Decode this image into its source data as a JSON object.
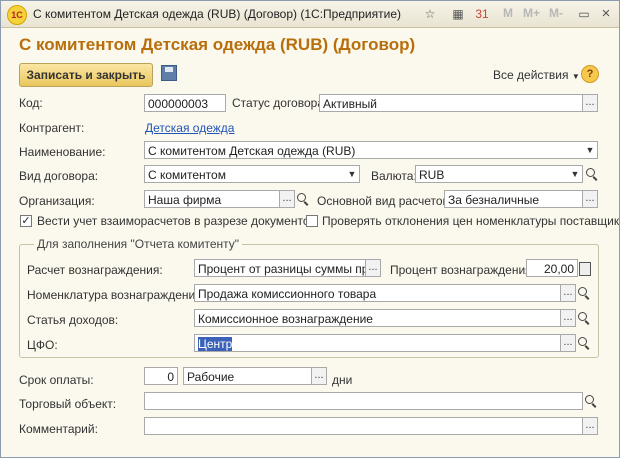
{
  "window": {
    "title": "С комитентом Детская одежда (RUB) (Договор)  (1С:Предприятие)",
    "logo_text": "1С",
    "toolbar": {
      "star_icon": "star-icon",
      "calc_icon": "calculator-icon",
      "calendar_icon": "calendar-icon",
      "calendar_text": "31",
      "mem_m": "M",
      "mem_mplus": "M+",
      "mem_mminus": "M-",
      "restore_icon": "restore-icon",
      "close_label": "×"
    }
  },
  "form": {
    "heading": "С комитентом Детская одежда (RUB) (Договор)",
    "save_close_label": "Записать и закрыть",
    "all_actions_label": "Все действия",
    "help_label": "?"
  },
  "fields": {
    "code_label": "Код:",
    "code_value": "000000003",
    "status_label": "Статус договора:",
    "status_value": "Активный",
    "counterparty_label": "Контрагент:",
    "counterparty_value": "Детская одежда",
    "name_label": "Наименование:",
    "name_value": "С комитентом Детская одежда (RUB)",
    "contract_type_label": "Вид договора:",
    "contract_type_value": "С комитентом",
    "currency_label": "Валюта:",
    "currency_value": "RUB",
    "org_label": "Организация:",
    "org_value": "Наша фирма",
    "settlement_label": "Основной вид расчетов:",
    "settlement_value": "За безналичные",
    "track_docs_label": "Вести учет взаиморасчетов в разрезе документов",
    "track_docs_checked": true,
    "check_prices_label": "Проверять отклонения цен номенклатуры поставщика",
    "check_prices_checked": false
  },
  "group": {
    "title": "Для заполнения \"Отчета комитенту\"",
    "reward_calc_label": "Расчет вознаграждения:",
    "reward_calc_value": "Процент от разницы суммы прод",
    "reward_percent_label": "Процент вознаграждения:",
    "reward_percent_value": "20,00",
    "reward_item_label": "Номенклатура вознаграждения:",
    "reward_item_value": "Продажа комиссионного товара",
    "income_item_label": "Статья доходов:",
    "income_item_value": "Комиссионное вознаграждение",
    "cfo_label": "ЦФО:",
    "cfo_value": "Центр"
  },
  "bottom": {
    "payment_term_label": "Срок оплаты:",
    "payment_term_value": "0",
    "payment_days_type": "Рабочие",
    "days_label": "дни",
    "trade_object_label": "Торговый объект:",
    "trade_object_value": "",
    "comment_label": "Комментарий:",
    "comment_value": ""
  }
}
